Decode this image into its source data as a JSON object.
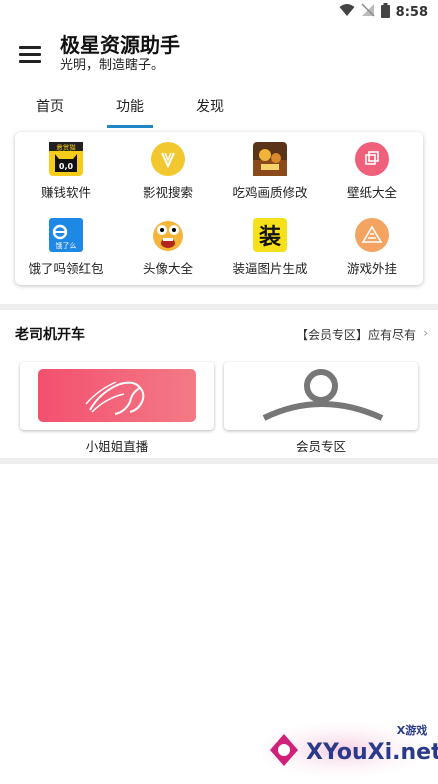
{
  "status_bar": {
    "time": "8:58"
  },
  "app": {
    "title": "极星资源助手",
    "subtitle": "光明，制造瞎子。"
  },
  "tabs": [
    {
      "label": "首页",
      "active": false
    },
    {
      "label": "功能",
      "active": true
    },
    {
      "label": "发现",
      "active": false
    }
  ],
  "features": [
    {
      "label": "赚钱软件",
      "icon": "cat-app-icon",
      "icon_text": "悬赏猫",
      "icon_sub": "0,0"
    },
    {
      "label": "影视搜索",
      "icon": "video-search-icon"
    },
    {
      "label": "吃鸡画质修改",
      "icon": "game-art-icon"
    },
    {
      "label": "壁纸大全",
      "icon": "wallpaper-icon"
    },
    {
      "label": "饿了吗领红包",
      "icon": "eleme-icon",
      "icon_text": "饿了么"
    },
    {
      "label": "头像大全",
      "icon": "emoji-face-icon"
    },
    {
      "label": "装逼图片生成",
      "icon": "zhuang-icon",
      "icon_text": "装"
    },
    {
      "label": "游戏外挂",
      "icon": "game-cheat-icon"
    }
  ],
  "section": {
    "title": "老司机开车",
    "more": "【会员专区】应有尽有"
  },
  "cards": [
    {
      "label": "小姐姐直播"
    },
    {
      "label": "会员专区"
    }
  ],
  "watermark": {
    "text": "XYouXi.net",
    "badge": "X游戏"
  },
  "colors": {
    "accent": "#1e88c7",
    "yellow": "#f2c830",
    "pink": "#f0607a",
    "orange": "#f4a460",
    "blue": "#1e88e5"
  }
}
